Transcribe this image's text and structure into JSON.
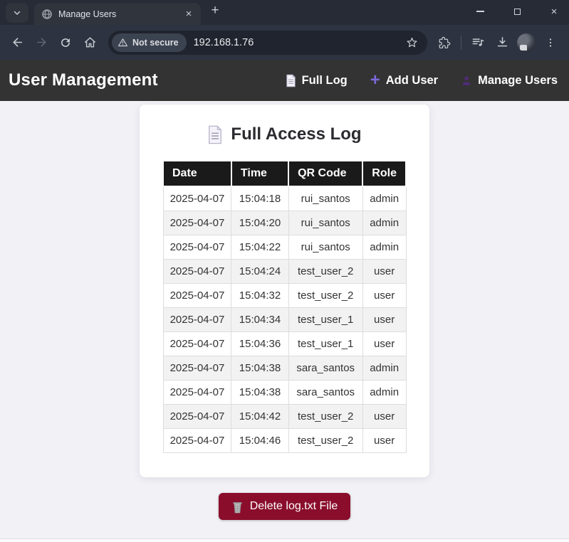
{
  "browser": {
    "tab_title": "Manage Users",
    "url": "192.168.1.76",
    "security_label": "Not secure"
  },
  "icons": {
    "tab_close": "×",
    "new_tab": "+",
    "window_minimize": "",
    "window_close": "×",
    "nav_plus": "+"
  },
  "header": {
    "title": "User Management",
    "nav": [
      {
        "label": "Full Log"
      },
      {
        "label": "Add User"
      },
      {
        "label": "Manage Users"
      }
    ]
  },
  "main": {
    "card_title": "Full Access Log",
    "table": {
      "columns": [
        "Date",
        "Time",
        "QR Code",
        "Role"
      ],
      "rows": [
        [
          "2025-04-07",
          "15:04:18",
          "rui_santos",
          "admin"
        ],
        [
          "2025-04-07",
          "15:04:20",
          "rui_santos",
          "admin"
        ],
        [
          "2025-04-07",
          "15:04:22",
          "rui_santos",
          "admin"
        ],
        [
          "2025-04-07",
          "15:04:24",
          "test_user_2",
          "user"
        ],
        [
          "2025-04-07",
          "15:04:32",
          "test_user_2",
          "user"
        ],
        [
          "2025-04-07",
          "15:04:34",
          "test_user_1",
          "user"
        ],
        [
          "2025-04-07",
          "15:04:36",
          "test_user_1",
          "user"
        ],
        [
          "2025-04-07",
          "15:04:38",
          "sara_santos",
          "admin"
        ],
        [
          "2025-04-07",
          "15:04:38",
          "sara_santos",
          "admin"
        ],
        [
          "2025-04-07",
          "15:04:42",
          "test_user_2",
          "user"
        ],
        [
          "2025-04-07",
          "15:04:46",
          "test_user_2",
          "user"
        ]
      ]
    },
    "delete_button_label": "Delete log.txt File"
  },
  "colors": {
    "accent_purple": "#7b68d9",
    "delete_button": "#8a0d2c",
    "table_header_bg": "#1a1a1a",
    "site_header_bg": "#333333",
    "page_bg": "#f1f1f6",
    "browser_frame": "#262b35",
    "row_stripe": "#f2f2f2"
  }
}
